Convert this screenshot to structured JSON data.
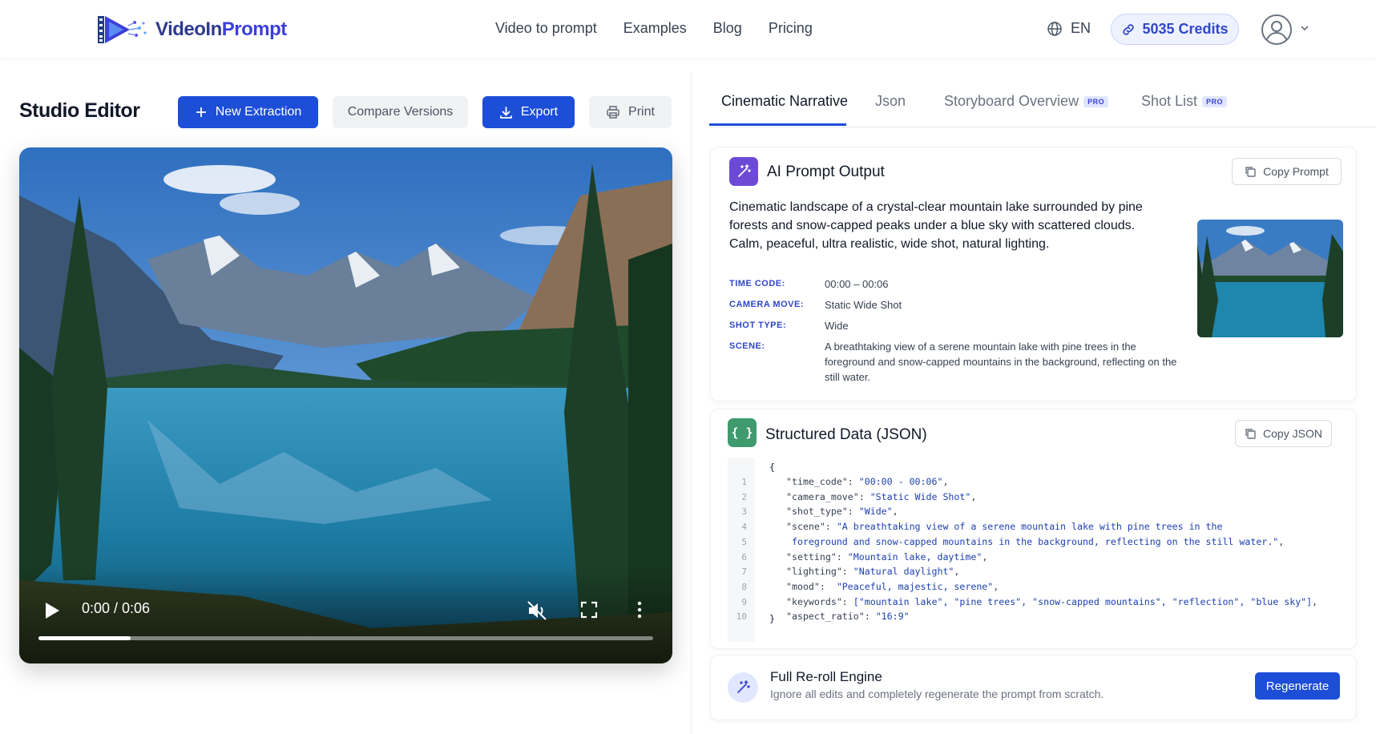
{
  "brand": {
    "name_part1": "VideoIn",
    "name_part2": "Prompt"
  },
  "nav": {
    "items": [
      "Video to prompt",
      "Examples",
      "Blog",
      "Pricing"
    ]
  },
  "header": {
    "language": "EN",
    "credits": "5035 Credits"
  },
  "studio": {
    "title": "Studio Editor",
    "new_extraction": "New Extraction",
    "compare_versions": "Compare Versions",
    "export": "Export",
    "print": "Print"
  },
  "player": {
    "time": "0:00 / 0:06",
    "progress": 0.15,
    "muted": true
  },
  "tabs": [
    {
      "label": "Cinematic Narrative",
      "active": true,
      "badge": ""
    },
    {
      "label": "Json",
      "active": false,
      "badge": ""
    },
    {
      "label": "Storyboard Overview",
      "active": false,
      "badge": "PRO"
    },
    {
      "label": "Shot List",
      "active": false,
      "badge": "PRO"
    }
  ],
  "prompt_card": {
    "title": "AI Prompt Output",
    "copy_label": "Copy Prompt",
    "text": "Cinematic landscape of a crystal-clear mountain lake surrounded by pine forests and snow-capped peaks under a blue sky with scattered clouds. Calm, peaceful, ultra realistic, wide shot, natural lighting.",
    "meta": [
      {
        "label": "TIME CODE:",
        "value": "00:00 – 00:06"
      },
      {
        "label": "CAMERA MOVE:",
        "value": "Static Wide Shot"
      },
      {
        "label": "SHOT TYPE:",
        "value": "Wide"
      },
      {
        "label": "SCENE:",
        "value": "A breathtaking view of a serene mountain lake with pine trees in the foreground and snow-capped mountains in the background, reflecting on the still water."
      }
    ]
  },
  "json_card": {
    "title": "Structured Data (JSON)",
    "copy_label": "Copy JSON",
    "open_brace": "{",
    "close_brace": "}",
    "lines": [
      {
        "n": "1",
        "key": "\"time_code\": ",
        "val": "\"00:00 - 00:06\"",
        "tail": ","
      },
      {
        "n": "2",
        "key": "\"camera_move\": ",
        "val": "\"Static Wide Shot\"",
        "tail": ","
      },
      {
        "n": "3",
        "key": "\"shot_type\": ",
        "val": "\"Wide\"",
        "tail": ","
      },
      {
        "n": "4",
        "key": "\"scene\": ",
        "val": "\"A breathtaking view of a serene mountain lake with pine trees in the",
        "tail": ""
      },
      {
        "n": "5",
        "key": " ",
        "val": "foreground and snow-capped mountains in the background, reflecting on the still water.\"",
        "tail": ","
      },
      {
        "n": "6",
        "key": "\"setting\": ",
        "val": "\"Mountain lake, daytime\"",
        "tail": ","
      },
      {
        "n": "7",
        "key": "\"lighting\": ",
        "val": "\"Natural daylight\"",
        "tail": ","
      },
      {
        "n": "8",
        "key": "\"mood\":  ",
        "val": "\"Peaceful, majestic, serene\"",
        "tail": ","
      },
      {
        "n": "9",
        "key": "\"keywords\": ",
        "val": "[\"mountain lake\", \"pine trees\", \"snow-capped mountains\", \"reflection\", \"blue sky\"]",
        "tail": ","
      },
      {
        "n": "10",
        "key": "\"aspect_ratio\": ",
        "val": "\"16:9\"",
        "tail": ""
      }
    ]
  },
  "reroll_card": {
    "title": "Full Re-roll Engine",
    "subtitle": "Ignore all edits and completely regenerate the prompt from scratch.",
    "button": "Regenerate"
  },
  "colors": {
    "primary": "#1d4ed8",
    "accent_purple": "#6d4ad6",
    "accent_green": "#3f9a6e"
  }
}
